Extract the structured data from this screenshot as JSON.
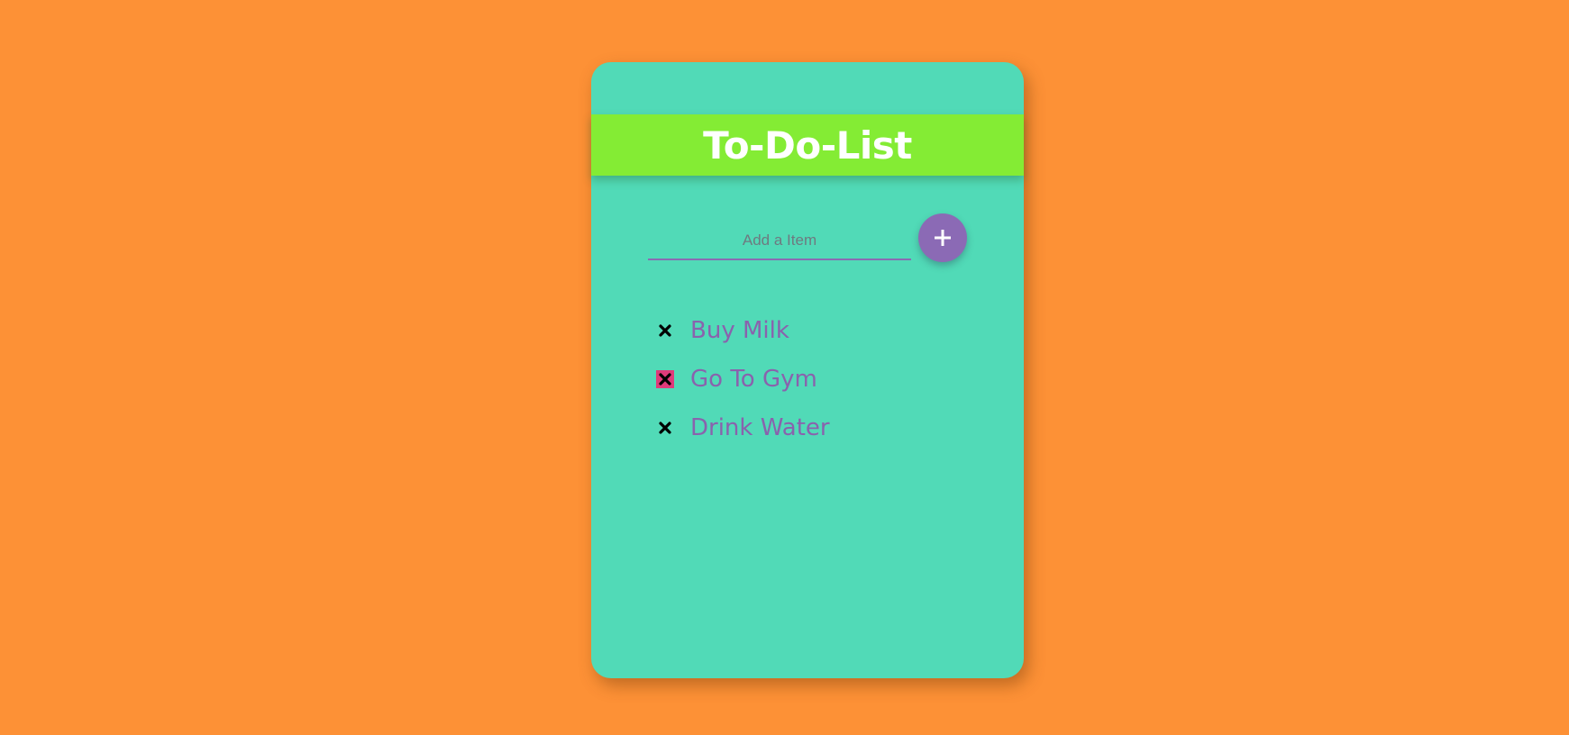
{
  "app": {
    "title": "To-Do-List"
  },
  "input": {
    "placeholder": "Add a Item",
    "value": ""
  },
  "add_button": {
    "icon": "plus-icon"
  },
  "items": [
    {
      "label": "Buy Milk",
      "icon": "close-icon",
      "highlighted": false
    },
    {
      "label": "Go To Gym",
      "icon": "close-icon",
      "highlighted": true
    },
    {
      "label": "Drink Water",
      "icon": "close-icon",
      "highlighted": false
    }
  ],
  "colors": {
    "background": "#fd9136",
    "card": "#51dab7",
    "header": "#84ec34",
    "accent": "#8b6ab5",
    "item_text": "#8a62ad",
    "delete_hover": "#e03a7a"
  }
}
